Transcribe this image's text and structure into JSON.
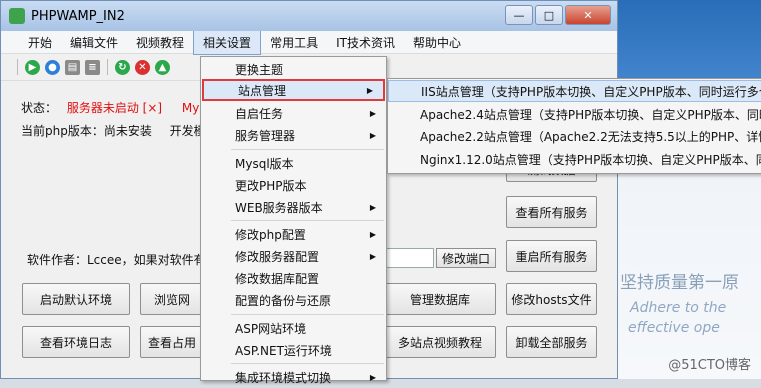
{
  "window": {
    "title": "PHPWAMP_IN2",
    "controls": {
      "minimize": "—",
      "maximize": "□",
      "close": "✕"
    }
  },
  "menubar": {
    "items": [
      "开始",
      "编辑文件",
      "视频教程",
      "相关设置",
      "常用工具",
      "IT技术资讯",
      "帮助中心"
    ],
    "active_index": 3
  },
  "toolbar": {
    "icons": [
      {
        "name": "play-icon",
        "color": "#2aa84a",
        "glyph": "▶"
      },
      {
        "name": "globe-icon",
        "color": "#2f7fd8",
        "glyph": "●"
      },
      {
        "name": "folder-icon",
        "color": "#8a8a8a",
        "glyph": "▤"
      },
      {
        "name": "database-icon",
        "color": "#8a8a8a",
        "glyph": "≡"
      },
      {
        "name": "refresh-icon",
        "color": "#2aa84a",
        "glyph": "↻"
      },
      {
        "name": "stop-icon",
        "color": "#d93030",
        "glyph": "✕"
      },
      {
        "name": "up-icon",
        "color": "#2aa84a",
        "glyph": "▲"
      }
    ]
  },
  "status": {
    "label": "状态：",
    "server_status": "服务器未启动 [×]",
    "mysql_prefix": "My"
  },
  "php": {
    "version_label": "当前php版本：尚未安装",
    "dev_mode_prefix": "开发模"
  },
  "author_text": "软件作者：Lccee，如果对软件有",
  "port_button": "修改端口",
  "side_buttons": {
    "view_services": "查看所有服务",
    "restart_services": "重启所有服务",
    "edit_hosts": "修改hosts文件",
    "uninstall_services": "卸载全部服务",
    "partial_top": "测试数据"
  },
  "bottom_buttons": {
    "start_default": "启动默认环境",
    "browse": "浏览网",
    "view_log": "查看环境日志",
    "view_usage": "查看占用",
    "manage_db": "管理数据库",
    "multi_site_video": "多站点视频教程"
  },
  "dropdown": {
    "items": [
      {
        "label": "更换主题",
        "submenu": false
      },
      {
        "label": "站点管理",
        "submenu": true,
        "selected": true
      },
      {
        "label": "自启任务",
        "submenu": true
      },
      {
        "label": "服务管理器",
        "submenu": true
      },
      {
        "label": "Mysql版本",
        "submenu": false
      },
      {
        "label": "更改PHP版本",
        "submenu": false
      },
      {
        "label": "WEB服务器版本",
        "submenu": true
      },
      {
        "label": "修改php配置",
        "submenu": true
      },
      {
        "label": "修改服务器配置",
        "submenu": true
      },
      {
        "label": "修改数据库配置",
        "submenu": false
      },
      {
        "label": "配置的备份与还原",
        "submenu": false
      },
      {
        "label": "ASP网站环境",
        "submenu": false
      },
      {
        "label": "ASP.NET运行环境",
        "submenu": false
      },
      {
        "label": "集成环境模式切换",
        "submenu": true
      }
    ]
  },
  "submenu": {
    "items": [
      "IIS站点管理（支持PHP版本切换、自定义PHP版本、同时运行多个",
      "Apache2.4站点管理（支持PHP版本切换、自定义PHP版本、同时",
      "Apache2.2站点管理（Apache2.2无法支持5.5以上的PHP、详情",
      "Nginx1.12.0站点管理（支持PHP版本切换、自定义PHP版本、同"
    ]
  },
  "background": {
    "slogan": "坚持质量第一原",
    "tagline1": "Adhere to the",
    "tagline2": "effective ope",
    "watermark": "@51CTO博客"
  }
}
